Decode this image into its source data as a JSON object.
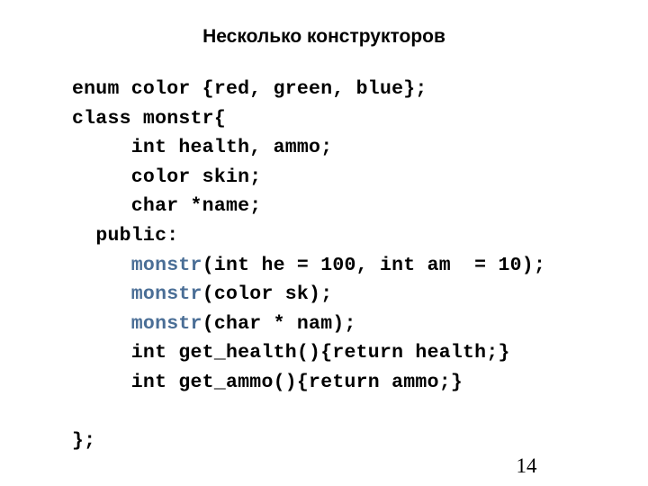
{
  "slide": {
    "title": "Несколько конструкторов",
    "page_number": "14",
    "background_color": "#ffffff",
    "text_color": "#000000",
    "accent_color": "#4A6E96"
  },
  "code": {
    "language": "cpp",
    "lines": [
      {
        "indent": "",
        "text": "enum color {red, green, blue};"
      },
      {
        "indent": "",
        "text": "class monstr{"
      },
      {
        "indent": "     ",
        "text": "int health, ammo;"
      },
      {
        "indent": "     ",
        "text": "color skin;"
      },
      {
        "indent": "     ",
        "text": "char *name;"
      },
      {
        "indent": "  ",
        "text": "public:"
      },
      {
        "indent": "     ",
        "keyword": "monstr",
        "text": "(int he = 100, int am  = 10);"
      },
      {
        "indent": "     ",
        "keyword": "monstr",
        "text": "(color sk);"
      },
      {
        "indent": "     ",
        "keyword": "monstr",
        "text": "(char * nam);"
      },
      {
        "indent": "     ",
        "text": "int get_health(){return health;}"
      },
      {
        "indent": "     ",
        "text": "int get_ammo(){return ammo;}"
      },
      {
        "indent": "",
        "text": ""
      },
      {
        "indent": "",
        "text": "};"
      }
    ]
  }
}
